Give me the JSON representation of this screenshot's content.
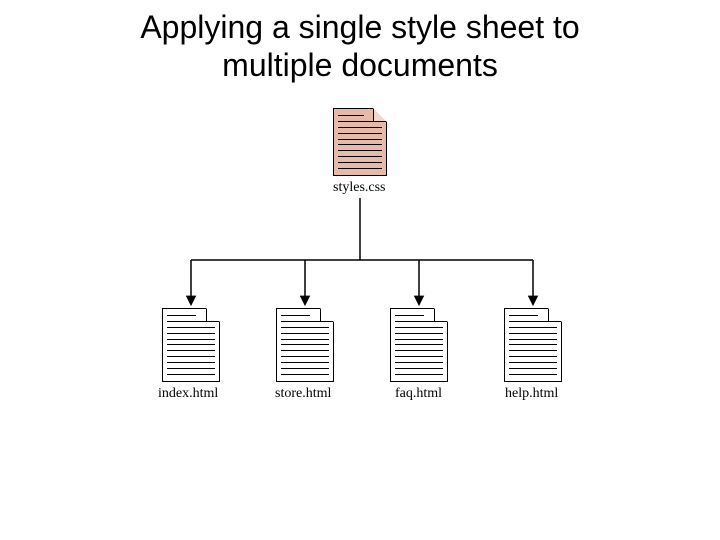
{
  "title_line1": "Applying a single style sheet to",
  "title_line2": "multiple documents",
  "css_file": "styles.css",
  "html_files": [
    "index.html",
    "store.html",
    "faq.html",
    "help.html"
  ]
}
